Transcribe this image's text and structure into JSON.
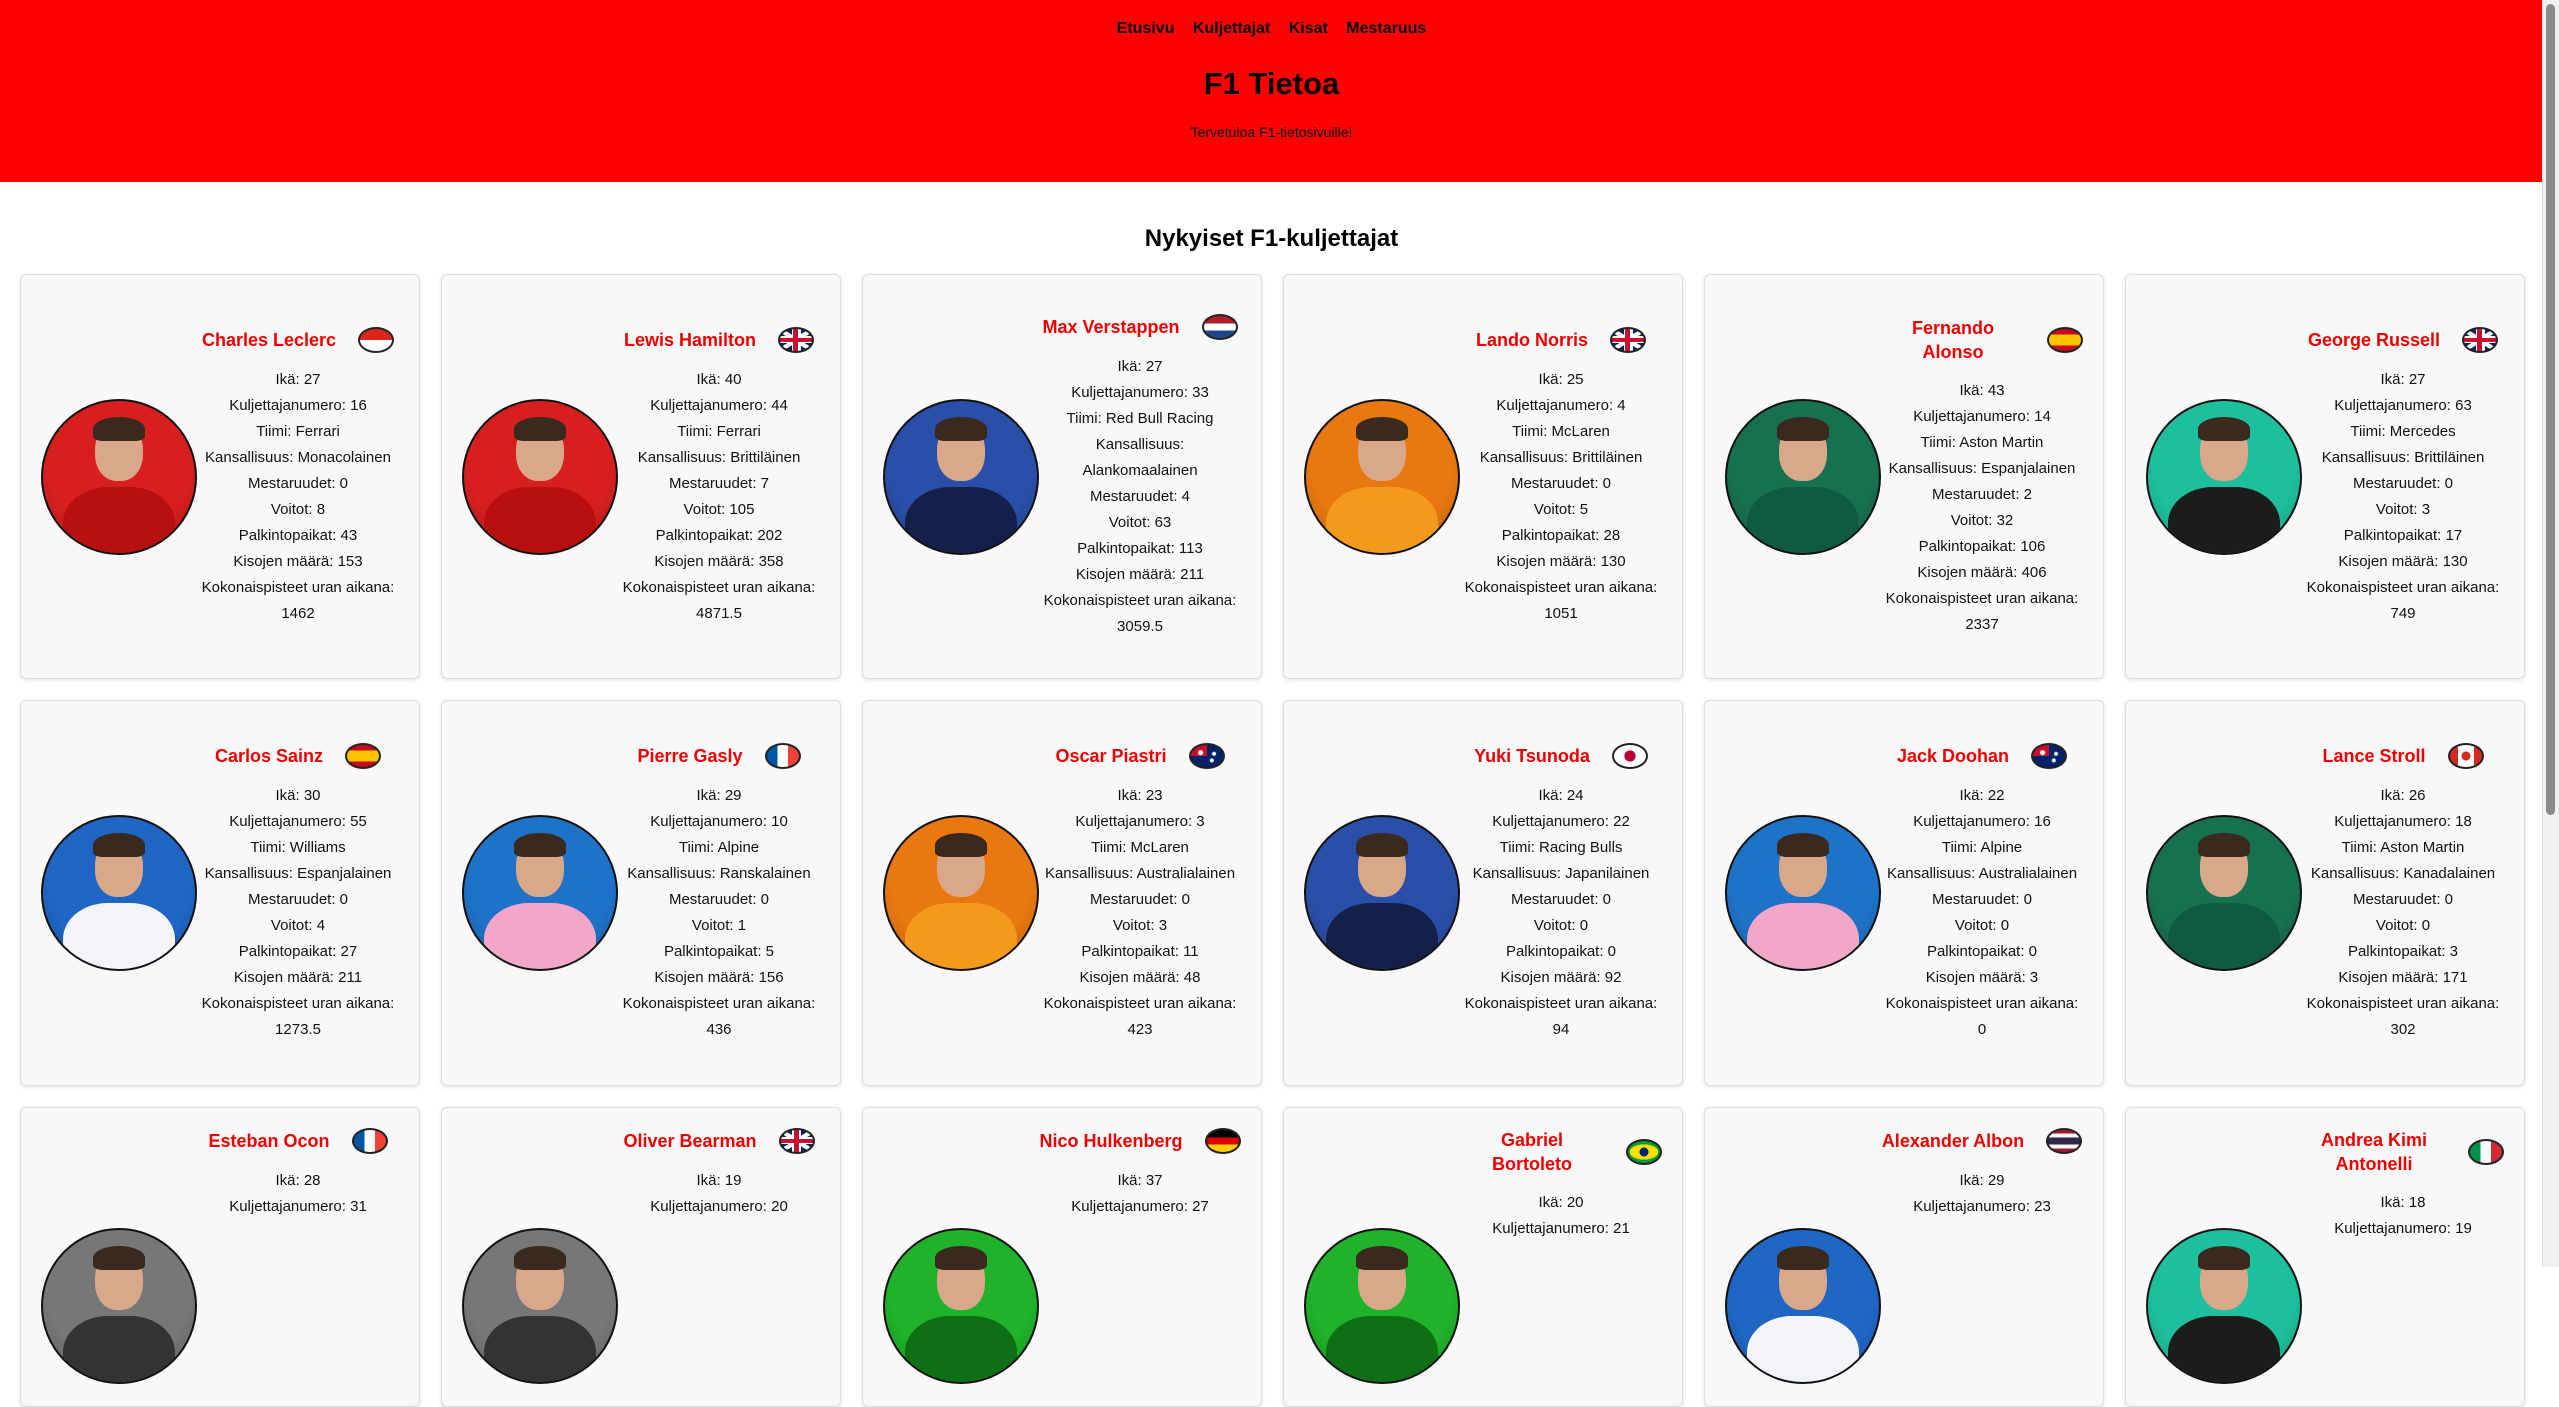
{
  "nav": [
    "Etusivu",
    "Kuljettajat",
    "Kisat",
    "Mestaruus"
  ],
  "site": {
    "title": "F1 Tietoa",
    "welcome": "Tervetuloa F1-tietosivuille!"
  },
  "section_title": "Nykyiset F1-kuljettajat",
  "drivers": [
    {
      "name": "Charles Leclerc",
      "stats": [
        "Ikä: 27",
        "Kuljettajanumero: 16",
        "Tiimi: Ferrari",
        "Kansallisuus: Monacolainen",
        "Mestaruudet: 0",
        "Voitot: 8",
        "Palkintopaikat: 43",
        "Kisojen määrä: 153",
        "Kokonaispisteet uran aikana: 1462"
      ],
      "flag_icon": "monaco-flag-icon",
      "bg": "#d81f1f",
      "suit": "#b80f0f"
    },
    {
      "name": "Lewis Hamilton",
      "stats": [
        "Ikä: 40",
        "Kuljettajanumero: 44",
        "Tiimi: Ferrari",
        "Kansallisuus: Brittiläinen",
        "Mestaruudet: 7",
        "Voitot: 105",
        "Palkintopaikat: 202",
        "Kisojen määrä: 358",
        "Kokonaispisteet uran aikana: 4871.5"
      ],
      "flag_icon": "uk-flag-icon",
      "bg": "#d81f1f",
      "suit": "#b80f0f"
    },
    {
      "name": "Max Verstappen",
      "stats": [
        "Ikä: 27",
        "Kuljettajanumero: 33",
        "Tiimi: Red Bull Racing",
        "Kansallisuus: Alankomaalainen",
        "Mestaruudet: 4",
        "Voitot: 63",
        "Palkintopaikat: 113",
        "Kisojen määrä: 211",
        "Kokonaispisteet uran aikana: 3059.5"
      ],
      "flag_icon": "netherlands-flag-icon",
      "bg": "#2a4fa8",
      "suit": "#15204a"
    },
    {
      "name": "Lando Norris",
      "stats": [
        "Ikä: 25",
        "Kuljettajanumero: 4",
        "Tiimi: McLaren",
        "Kansallisuus: Brittiläinen",
        "Mestaruudet: 0",
        "Voitot: 5",
        "Palkintopaikat: 28",
        "Kisojen määrä: 130",
        "Kokonaispisteet uran aikana: 1051"
      ],
      "flag_icon": "uk-flag-icon",
      "bg": "#e8780f",
      "suit": "#f39a1c"
    },
    {
      "name": "Fernando Alonso",
      "stats": [
        "Ikä: 43",
        "Kuljettajanumero: 14",
        "Tiimi: Aston Martin",
        "Kansallisuus: Espanjalainen",
        "Mestaruudet: 2",
        "Voitot: 32",
        "Palkintopaikat: 106",
        "Kisojen määrä: 406",
        "Kokonaispisteet uran aikana: 2337"
      ],
      "flag_icon": "spain-flag-icon",
      "bg": "#17714f",
      "suit": "#0f5a40"
    },
    {
      "name": "George Russell",
      "stats": [
        "Ikä: 27",
        "Kuljettajanumero: 63",
        "Tiimi: Mercedes",
        "Kansallisuus: Brittiläinen",
        "Mestaruudet: 0",
        "Voitot: 3",
        "Palkintopaikat: 17",
        "Kisojen määrä: 130",
        "Kokonaispisteet uran aikana: 749"
      ],
      "flag_icon": "uk-flag-icon",
      "bg": "#1ebf9c",
      "suit": "#1c1c1c"
    },
    {
      "name": "Carlos Sainz",
      "stats": [
        "Ikä: 30",
        "Kuljettajanumero: 55",
        "Tiimi: Williams",
        "Kansallisuus: Espanjalainen",
        "Mestaruudet: 0",
        "Voitot: 4",
        "Palkintopaikat: 27",
        "Kisojen määrä: 211",
        "Kokonaispisteet uran aikana: 1273.5"
      ],
      "flag_icon": "spain-flag-icon",
      "bg": "#1f66c4",
      "suit": "#f2f4fa"
    },
    {
      "name": "Pierre Gasly",
      "stats": [
        "Ikä: 29",
        "Kuljettajanumero: 10",
        "Tiimi: Alpine",
        "Kansallisuus: Ranskalainen",
        "Mestaruudet: 0",
        "Voitot: 1",
        "Palkintopaikat: 5",
        "Kisojen määrä: 156",
        "Kokonaispisteet uran aikana: 436"
      ],
      "flag_icon": "france-flag-icon",
      "bg": "#1e73c8",
      "suit": "#f2a6c8"
    },
    {
      "name": "Oscar Piastri",
      "stats": [
        "Ikä: 23",
        "Kuljettajanumero: 3",
        "Tiimi: McLaren",
        "Kansallisuus: Australialainen",
        "Mestaruudet: 0",
        "Voitot: 3",
        "Palkintopaikat: 11",
        "Kisojen määrä: 48",
        "Kokonaispisteet uran aikana: 423"
      ],
      "flag_icon": "australia-flag-icon",
      "bg": "#e8780f",
      "suit": "#f39a1c"
    },
    {
      "name": "Yuki Tsunoda",
      "stats": [
        "Ikä: 24",
        "Kuljettajanumero: 22",
        "Tiimi: Racing Bulls",
        "Kansallisuus: Japanilainen",
        "Mestaruudet: 0",
        "Voitot: 0",
        "Palkintopaikat: 0",
        "Kisojen määrä: 92",
        "Kokonaispisteet uran aikana: 94"
      ],
      "flag_icon": "japan-flag-icon",
      "bg": "#2a4fa8",
      "suit": "#15204a"
    },
    {
      "name": "Jack Doohan",
      "stats": [
        "Ikä: 22",
        "Kuljettajanumero: 16",
        "Tiimi: Alpine",
        "Kansallisuus: Australialainen",
        "Mestaruudet: 0",
        "Voitot: 0",
        "Palkintopaikat: 0",
        "Kisojen määrä: 3",
        "Kokonaispisteet uran aikana: 0"
      ],
      "flag_icon": "australia-flag-icon",
      "bg": "#1e73c8",
      "suit": "#f2a6c8"
    },
    {
      "name": "Lance Stroll",
      "stats": [
        "Ikä: 26",
        "Kuljettajanumero: 18",
        "Tiimi: Aston Martin",
        "Kansallisuus: Kanadalainen",
        "Mestaruudet: 0",
        "Voitot: 0",
        "Palkintopaikat: 3",
        "Kisojen määrä: 171",
        "Kokonaispisteet uran aikana: 302"
      ],
      "flag_icon": "canada-flag-icon",
      "bg": "#17714f",
      "suit": "#0f5a40"
    },
    {
      "name": "Esteban Ocon",
      "stats": [
        "Ikä: 28",
        "Kuljettajanumero: 31"
      ],
      "flag_icon": "france-flag-icon",
      "bg": "#777777",
      "suit": "#333333"
    },
    {
      "name": "Oliver Bearman",
      "stats": [
        "Ikä: 19",
        "Kuljettajanumero: 20"
      ],
      "flag_icon": "uk-flag-icon",
      "bg": "#777777",
      "suit": "#333333"
    },
    {
      "name": "Nico Hulkenberg",
      "stats": [
        "Ikä: 37",
        "Kuljettajanumero: 27"
      ],
      "flag_icon": "germany-flag-icon",
      "bg": "#1fb22a",
      "suit": "#0e6f14"
    },
    {
      "name": "Gabriel Bortoleto",
      "stats": [
        "Ikä: 20",
        "Kuljettajanumero: 21"
      ],
      "flag_icon": "brazil-flag-icon",
      "bg": "#1fb22a",
      "suit": "#0e6f14"
    },
    {
      "name": "Alexander Albon",
      "stats": [
        "Ikä: 29",
        "Kuljettajanumero: 23"
      ],
      "flag_icon": "thailand-flag-icon",
      "bg": "#1f66c4",
      "suit": "#f2f4fa"
    },
    {
      "name": "Andrea Kimi Antonelli",
      "stats": [
        "Ikä: 18",
        "Kuljettajanumero: 19"
      ],
      "flag_icon": "italy-flag-icon",
      "bg": "#1ebf9c",
      "suit": "#1c1c1c"
    }
  ]
}
